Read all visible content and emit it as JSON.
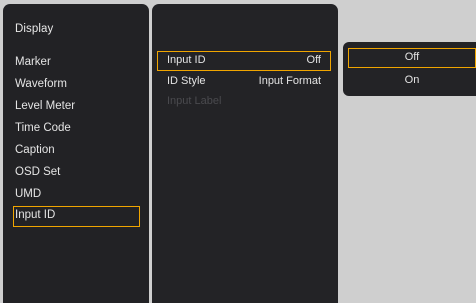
{
  "menu": {
    "title": "Display",
    "items": [
      {
        "label": "Marker"
      },
      {
        "label": "Waveform"
      },
      {
        "label": "Level Meter"
      },
      {
        "label": "Time Code"
      },
      {
        "label": "Caption"
      },
      {
        "label": "OSD Set"
      },
      {
        "label": "UMD"
      },
      {
        "label": "Input ID"
      }
    ],
    "selected_index": 7
  },
  "submenu": {
    "rows": [
      {
        "label": "Input ID",
        "value": "Off"
      },
      {
        "label": "ID Style",
        "value": "Input Format"
      },
      {
        "label": "Input Label",
        "value": ""
      }
    ]
  },
  "options": {
    "items": [
      {
        "label": "Off"
      },
      {
        "label": "On"
      }
    ],
    "selected_index": 0
  },
  "colors": {
    "highlight_border": "#f0a500",
    "panel_background": "#232326",
    "screen_background": "#cfcfcf",
    "text": "#e4e4e4",
    "disabled_text": "#4a4a4e"
  }
}
